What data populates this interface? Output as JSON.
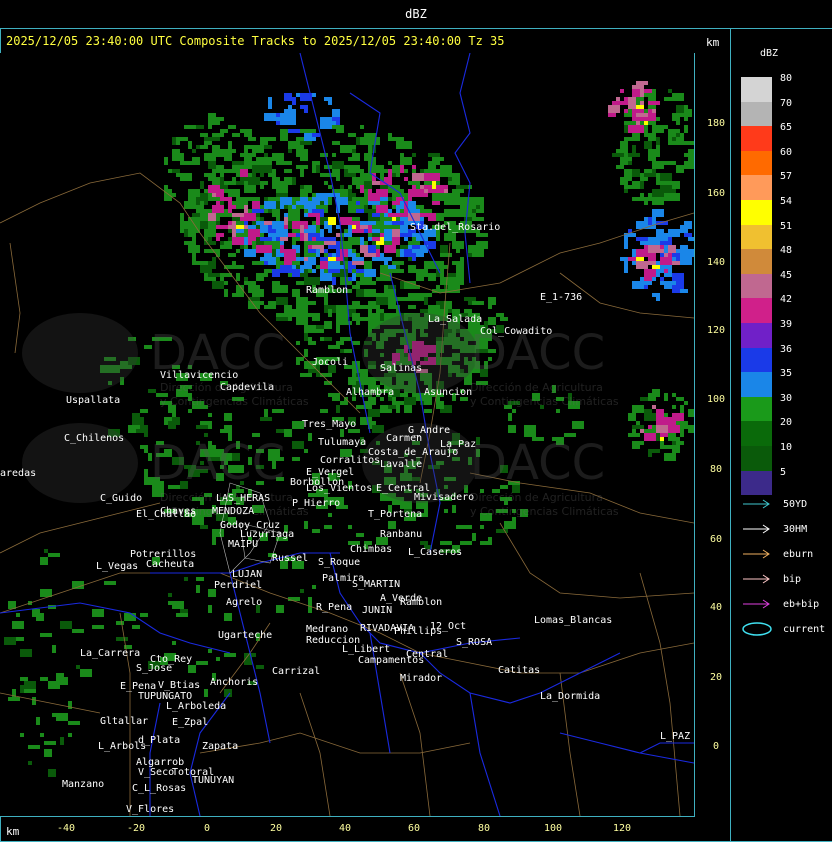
{
  "header": {
    "title": "dBZ"
  },
  "subtitle": "2025/12/05 23:40:00 UTC Composite Tracks to 2025/12/05 23:40:00 Tz 35",
  "units": {
    "km_top": "km",
    "km_bottom": "km"
  },
  "axes": {
    "x_ticks": [
      "-40",
      "-20",
      "0",
      "20",
      "40",
      "60",
      "80",
      "100",
      "120"
    ],
    "y_ticks": [
      "180",
      "160",
      "140",
      "120",
      "100",
      "80",
      "60",
      "40",
      "20",
      "0"
    ]
  },
  "legend": {
    "title": "dBZ",
    "levels": [
      {
        "label": "80",
        "color": "#d4d4d4"
      },
      {
        "label": "70",
        "color": "#b4b4b4"
      },
      {
        "label": "65",
        "color": "#ff3a1a"
      },
      {
        "label": "60",
        "color": "#ff6a00"
      },
      {
        "label": "57",
        "color": "#ff9a5a"
      },
      {
        "label": "54",
        "color": "#ffff00"
      },
      {
        "label": "51",
        "color": "#f0c030"
      },
      {
        "label": "48",
        "color": "#d08a3a"
      },
      {
        "label": "45",
        "color": "#c06890"
      },
      {
        "label": "42",
        "color": "#d0208a"
      },
      {
        "label": "39",
        "color": "#7020c8"
      },
      {
        "label": "36",
        "color": "#1a3ae8"
      },
      {
        "label": "35",
        "color": "#1a86e8"
      },
      {
        "label": "30",
        "color": "#1a9a1a"
      },
      {
        "label": "20",
        "color": "#0a6a0a"
      },
      {
        "label": "10",
        "color": "#0a5a0a"
      },
      {
        "label": "5",
        "color": "#3c2a8a"
      }
    ],
    "tracks": [
      {
        "label": "50YD",
        "color": "#40c8d0",
        "icon": "arrow-right-icon"
      },
      {
        "label": "30HM",
        "color": "#ffffff",
        "icon": "arrow-right-icon"
      },
      {
        "label": "eburn",
        "color": "#f0b060",
        "icon": "arrow-right-icon"
      },
      {
        "label": "bip",
        "color": "#ffc8c8",
        "icon": "arrow-right-icon"
      },
      {
        "label": "eb+bip",
        "color": "#e040e0",
        "icon": "arrow-right-icon"
      },
      {
        "label": "current",
        "color": "#40e0f0",
        "icon": "ellipse-icon"
      }
    ]
  },
  "watermark": {
    "logo_text": "DACC",
    "line1": "Dirección de Agricultura",
    "line2": "y Contingencias Climáticas"
  },
  "towns": [
    "Uspallata",
    "C_Chilenos",
    "aredas",
    "Villavicencio",
    "Capdevila",
    "Ramblon",
    "Sta.del_Rosario",
    "E_1-736",
    "La_Salada",
    "Col_Cowadito",
    "Asuncion",
    "Salinas",
    "Tres_Mayo",
    "Jocoli",
    "Tulumaya",
    "G_Andre",
    "Carmen",
    "C_Guido",
    "Alhambra",
    "El_Challao",
    "LAS_HERAS",
    "MENDOZA",
    "Chaves",
    "La_Paz",
    "Lavalle",
    "Los_Vientos",
    "Borbollon",
    "Corralitos",
    "P_Hierro",
    "E_Vergel",
    "Costa_de_Araujo",
    "E_Central",
    "T_Portena",
    "Mivisadero",
    "Ranbanu",
    "Godoy_Cruz",
    "LUJAN",
    "MAIPU",
    "Luzuriaga",
    "Russel",
    "Chimbas",
    "L_Caseros",
    "Potrerillos",
    "Cacheuta",
    "L_Vegas",
    "Perdriel",
    "Agrelo",
    "S_Roque",
    "Palmira",
    "S_MARTIN",
    "JUNIN",
    "A_Verde",
    "Ramblon",
    "R_Pena",
    "Medrano",
    "RIVADAVIA",
    "Phillips",
    "12_Oct",
    "Reduccion",
    "L_Libert",
    "Campamentos",
    "Central",
    "S_ROSA",
    "Lomas_Blancas",
    "Catitas",
    "Ugarteche",
    "Carrizal",
    "La_Carrera",
    "S_Jose",
    "Cto_Rey",
    "E_Pena",
    "V_Btias",
    "Anchoris",
    "TUPUNGATO",
    "L_Arboleda",
    "Gltallar",
    "E_Zpal",
    "La_Dormida",
    "L_Arbols",
    "d_Plata",
    "Zapata",
    "Algarrob",
    "V_Seco",
    "Totoral",
    "TUNUYAN",
    "Manzano",
    "C_L_Rosas",
    "V_Flores",
    "Mirador",
    "L_PAZ"
  ]
}
